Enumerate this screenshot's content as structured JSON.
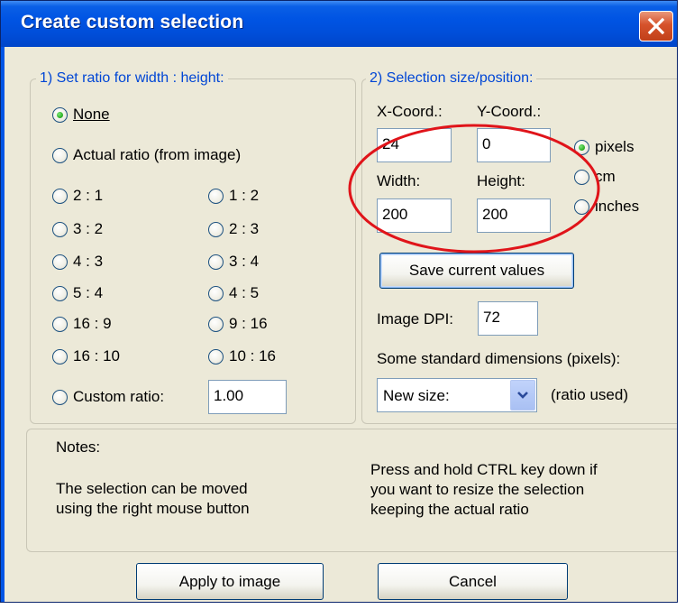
{
  "window": {
    "title": "Create custom selection",
    "close_icon": "close-x-icon"
  },
  "ratio_group": {
    "legend": "1) Set ratio for width : height:",
    "none": {
      "label": "None",
      "selected": true
    },
    "actual": {
      "label": "Actual ratio (from image)",
      "selected": false
    },
    "ratios": [
      "2 : 1",
      "1 : 2",
      "3 : 2",
      "2 : 3",
      "4 : 3",
      "3 : 4",
      "5 : 4",
      "4 : 5",
      "16 : 9",
      "9 : 16",
      "16 : 10",
      "10 : 16"
    ],
    "custom": {
      "label": "Custom ratio:",
      "value": "1.00",
      "selected": false
    }
  },
  "size_group": {
    "legend": "2) Selection size/position:",
    "x_label": "X-Coord.:",
    "x_value": "24",
    "y_label": "Y-Coord.:",
    "y_value": "0",
    "width_label": "Width:",
    "width_value": "200",
    "height_label": "Height:",
    "height_value": "200",
    "units": [
      {
        "label": "pixels",
        "selected": true
      },
      {
        "label": "cm",
        "selected": false
      },
      {
        "label": "inches",
        "selected": false
      }
    ],
    "save_button": "Save current values",
    "dpi_label": "Image DPI:",
    "dpi_value": "72",
    "standard_label": "Some standard dimensions (pixels):",
    "standard_selected": "New size:",
    "ratio_used": "(ratio used)"
  },
  "notes": {
    "title": "Notes:",
    "left_line1": "The selection can be moved",
    "left_line2": "using the right mouse button",
    "right_line1": "Press and hold CTRL key down if",
    "right_line2": "you want to resize the selection",
    "right_line3": "keeping the actual ratio"
  },
  "buttons": {
    "apply": "Apply to image",
    "cancel": "Cancel"
  },
  "annotation": {
    "color": "#e0141a"
  }
}
